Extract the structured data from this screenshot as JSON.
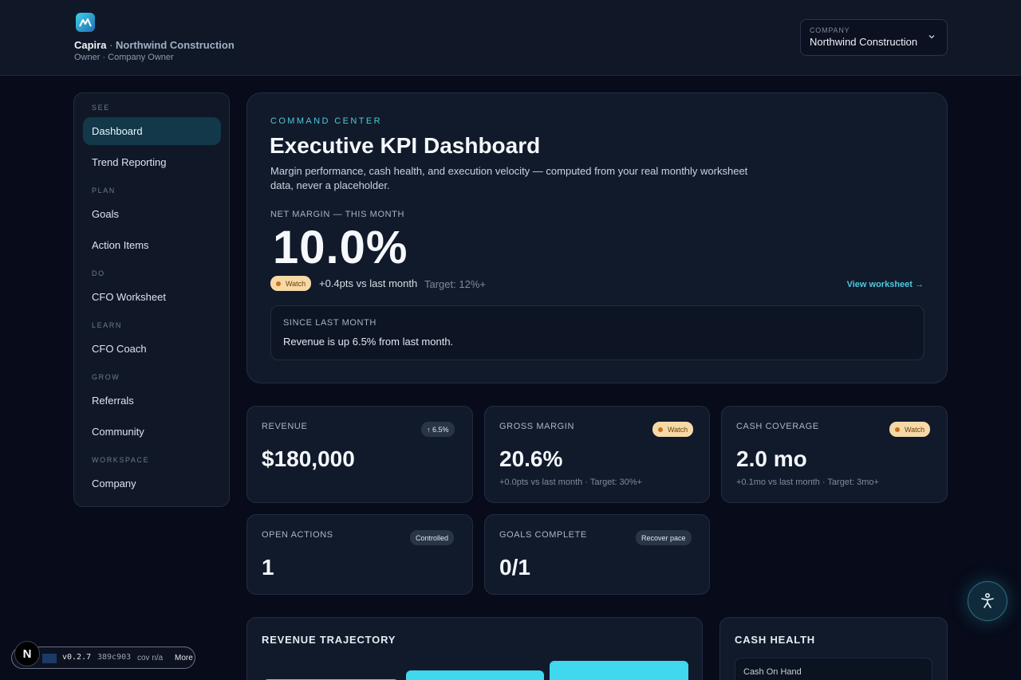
{
  "header": {
    "brand": "Capira",
    "separator": " · ",
    "company": "Northwind Construction",
    "role": "Owner · Company Owner",
    "company_select": {
      "label": "COMPANY",
      "value": "Northwind Construction"
    }
  },
  "sidebar": {
    "sections": [
      {
        "label": "SEE",
        "items": [
          {
            "label": "Dashboard",
            "active": true
          },
          {
            "label": "Trend Reporting"
          }
        ]
      },
      {
        "label": "PLAN",
        "items": [
          {
            "label": "Goals"
          },
          {
            "label": "Action Items"
          }
        ]
      },
      {
        "label": "DO",
        "items": [
          {
            "label": "CFO Worksheet"
          }
        ]
      },
      {
        "label": "LEARN",
        "items": [
          {
            "label": "CFO Coach"
          }
        ]
      },
      {
        "label": "GROW",
        "items": [
          {
            "label": "Referrals"
          },
          {
            "label": "Community"
          }
        ]
      },
      {
        "label": "WORKSPACE",
        "items": [
          {
            "label": "Company"
          }
        ]
      }
    ]
  },
  "hero": {
    "eyebrow": "COMMAND CENTER",
    "title": "Executive KPI Dashboard",
    "description": "Margin performance, cash health, and execution velocity — computed from your real monthly worksheet data, never a placeholder.",
    "metric_label": "NET MARGIN — THIS MONTH",
    "metric_value": "10.0%",
    "status": "Watch",
    "delta": "+0.4pts vs last month",
    "target": "Target: 12%+",
    "view_link": "View worksheet →",
    "since_label": "SINCE LAST MONTH",
    "since_text": "Revenue is up 6.5% from last month."
  },
  "kpis": {
    "revenue": {
      "label": "REVENUE",
      "badge": "↑ 6.5%",
      "value": "$180,000"
    },
    "gross_margin": {
      "label": "GROSS MARGIN",
      "badge": "Watch",
      "value": "20.6%",
      "sub": "+0.0pts vs last month · Target: 30%+"
    },
    "cash_coverage": {
      "label": "CASH COVERAGE",
      "badge": "Watch",
      "value": "2.0 mo",
      "sub": "+0.1mo vs last month · Target: 3mo+"
    },
    "open_actions": {
      "label": "OPEN ACTIONS",
      "badge": "Controlled",
      "value": "1"
    },
    "goals_complete": {
      "label": "GOALS COMPLETE",
      "badge": "Recover pace",
      "value": "0/1"
    }
  },
  "revenue_trajectory": {
    "title": "REVENUE TRAJECTORY"
  },
  "cash_health": {
    "title": "CASH HEALTH",
    "first_item": "Cash On Hand"
  },
  "devbar": {
    "badge": "N",
    "version": "v0.2.7",
    "hash": "389c903",
    "coverage": "cov n/a",
    "more": "More"
  },
  "colors": {
    "accent": "#4fc7dc",
    "watch_bg": "#f6d9a7",
    "bar": "#3fd8ee",
    "background": "#070b1a"
  }
}
